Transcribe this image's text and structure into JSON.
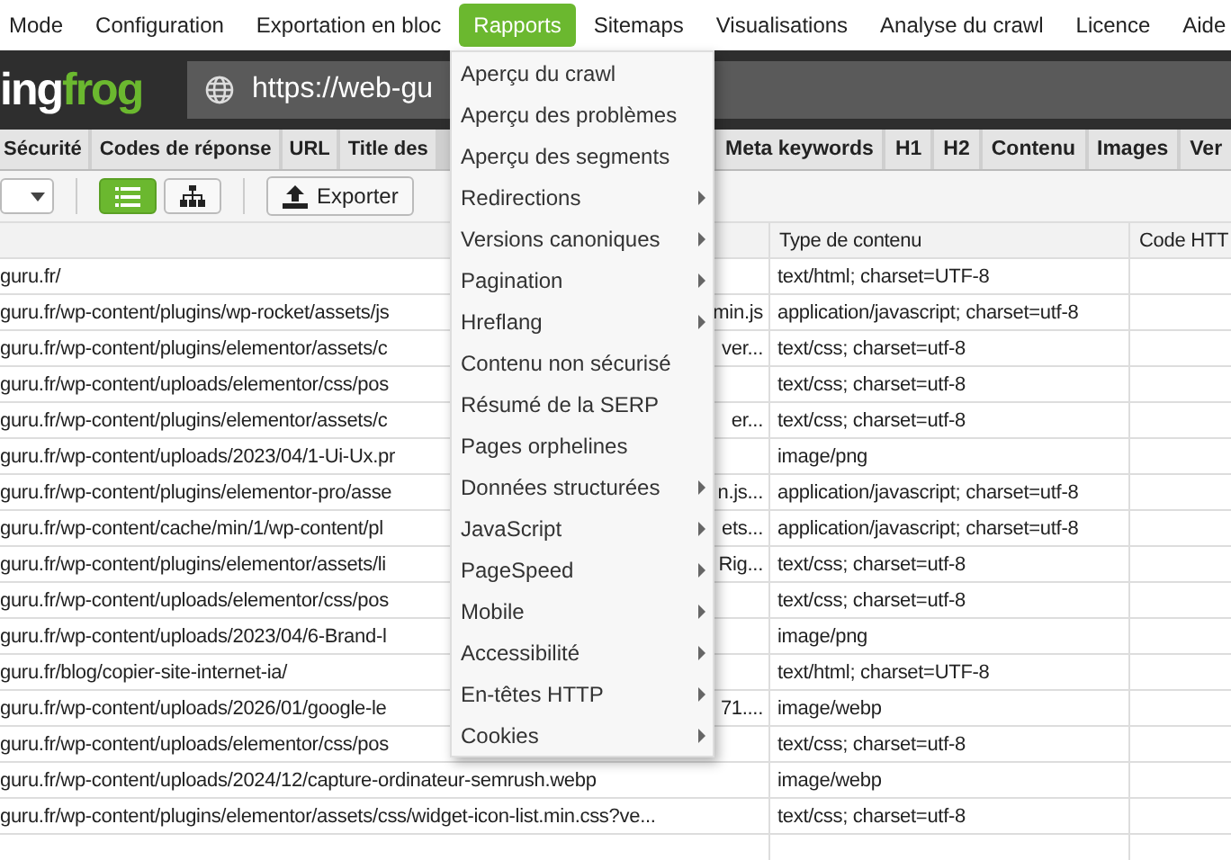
{
  "menubar": [
    {
      "label": "Mode",
      "selected": false
    },
    {
      "label": "Configuration",
      "selected": false
    },
    {
      "label": "Exportation en bloc",
      "selected": false
    },
    {
      "label": "Rapports",
      "selected": true
    },
    {
      "label": "Sitemaps",
      "selected": false
    },
    {
      "label": "Visualisations",
      "selected": false
    },
    {
      "label": "Analyse du crawl",
      "selected": false
    },
    {
      "label": "Licence",
      "selected": false
    },
    {
      "label": "Aide",
      "selected": false
    }
  ],
  "logo": {
    "parts": [
      "ing",
      "frog"
    ]
  },
  "url_field": {
    "value": "https://web-gu"
  },
  "tabs_left": [
    {
      "label": "Sécurité"
    },
    {
      "label": "Codes de réponse"
    },
    {
      "label": "URL"
    },
    {
      "label": "Title des"
    }
  ],
  "tabs_right": [
    {
      "label": "Meta keywords"
    },
    {
      "label": "H1"
    },
    {
      "label": "H2"
    },
    {
      "label": "Contenu"
    },
    {
      "label": "Images"
    },
    {
      "label": "Ver"
    }
  ],
  "toolbar": {
    "views": [
      {
        "kind": "list",
        "selected": true
      },
      {
        "kind": "tree",
        "selected": false
      }
    ],
    "export_button": "Exporter"
  },
  "table": {
    "columns": [
      "Type de contenu",
      "Code HTT"
    ],
    "rows": [
      {
        "url": "guru.fr/",
        "type": "text/html; charset=UTF-8"
      },
      {
        "url": "guru.fr/wp-content/plugins/wp-rocket/assets/js",
        "url_end": "min.js",
        "type": "application/javascript; charset=utf-8"
      },
      {
        "url": "guru.fr/wp-content/plugins/elementor/assets/c",
        "url_end": "ver...",
        "type": "text/css; charset=utf-8"
      },
      {
        "url": "guru.fr/wp-content/uploads/elementor/css/pos",
        "type": "text/css; charset=utf-8"
      },
      {
        "url": "guru.fr/wp-content/plugins/elementor/assets/c",
        "url_end": "er...",
        "type": "text/css; charset=utf-8"
      },
      {
        "url": "guru.fr/wp-content/uploads/2023/04/1-Ui-Ux.pr",
        "type": "image/png"
      },
      {
        "url": "guru.fr/wp-content/plugins/elementor-pro/asse",
        "url_end": "n.js...",
        "type": "application/javascript; charset=utf-8"
      },
      {
        "url": "guru.fr/wp-content/cache/min/1/wp-content/pl",
        "url_end": "ets...",
        "type": "application/javascript; charset=utf-8"
      },
      {
        "url": "guru.fr/wp-content/plugins/elementor/assets/li",
        "url_end": "Rig...",
        "type": "text/css; charset=utf-8"
      },
      {
        "url": "guru.fr/wp-content/uploads/elementor/css/pos",
        "type": "text/css; charset=utf-8"
      },
      {
        "url": "guru.fr/wp-content/uploads/2023/04/6-Brand-l",
        "type": "image/png"
      },
      {
        "url": "guru.fr/blog/copier-site-internet-ia/",
        "type": "text/html; charset=UTF-8"
      },
      {
        "url": "guru.fr/wp-content/uploads/2026/01/google-le",
        "url_end": "71....",
        "type": "image/webp"
      },
      {
        "url": "guru.fr/wp-content/uploads/elementor/css/pos",
        "type": "text/css; charset=utf-8"
      },
      {
        "url": "guru.fr/wp-content/uploads/2024/12/capture-ordinateur-semrush.webp",
        "type": "image/webp"
      },
      {
        "url": "guru.fr/wp-content/plugins/elementor/assets/css/widget-icon-list.min.css?ve...",
        "type": "text/css; charset=utf-8"
      }
    ]
  },
  "dropdown_menu": [
    {
      "label": "Aperçu du crawl",
      "submenu": false
    },
    {
      "label": "Aperçu des problèmes",
      "submenu": false
    },
    {
      "label": "Aperçu des segments",
      "submenu": false
    },
    {
      "label": "Redirections",
      "submenu": true
    },
    {
      "label": "Versions canoniques",
      "submenu": true
    },
    {
      "label": "Pagination",
      "submenu": true
    },
    {
      "label": "Hreflang",
      "submenu": true
    },
    {
      "label": "Contenu non sécurisé",
      "submenu": false
    },
    {
      "label": "Résumé de la SERP",
      "submenu": false
    },
    {
      "label": "Pages orphelines",
      "submenu": false
    },
    {
      "label": "Données structurées",
      "submenu": true
    },
    {
      "label": "JavaScript",
      "submenu": true
    },
    {
      "label": "PageSpeed",
      "submenu": true
    },
    {
      "label": "Mobile",
      "submenu": true
    },
    {
      "label": "Accessibilité",
      "submenu": true
    },
    {
      "label": "En-têtes HTTP",
      "submenu": true
    },
    {
      "label": "Cookies",
      "submenu": true
    }
  ]
}
